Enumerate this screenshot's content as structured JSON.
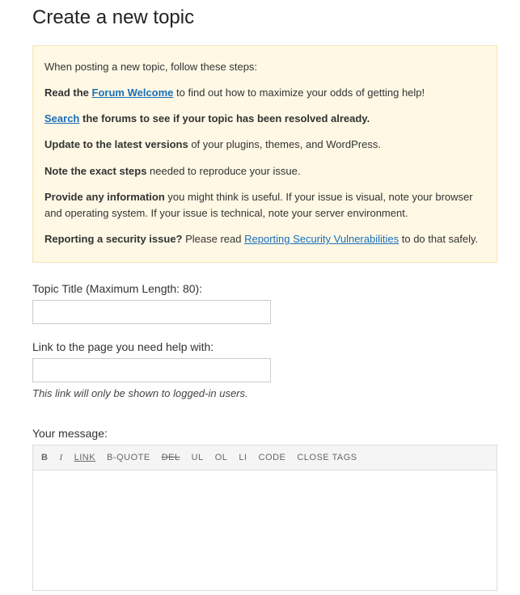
{
  "heading": "Create a new topic",
  "notice": {
    "intro": "When posting a new topic, follow these steps:",
    "read_prefix": "Read the ",
    "read_link": "Forum Welcome",
    "read_suffix": " to find out how to maximize your odds of getting help!",
    "search_link": "Search",
    "search_suffix": " the forums to see if your topic has been resolved already.",
    "update_bold": "Update to the latest versions",
    "update_suffix": " of your plugins, themes, and WordPress.",
    "note_bold": "Note the exact steps",
    "note_suffix": " needed to reproduce your issue.",
    "provide_bold": "Provide any information",
    "provide_suffix": " you might think is useful. If your issue is visual, note your browser and operating system. If your issue is technical, note your server environment.",
    "report_bold": "Reporting a security issue?",
    "report_mid": " Please read ",
    "report_link": "Reporting Security Vulnerabilities",
    "report_suffix": " to do that safely."
  },
  "form": {
    "title_label": "Topic Title (Maximum Length: 80):",
    "title_value": "",
    "link_label": "Link to the page you need help with:",
    "link_value": "",
    "link_hint": "This link will only be shown to logged-in users.",
    "message_label": "Your message:",
    "message_value": ""
  },
  "toolbar": {
    "b": "B",
    "i": "I",
    "link": "LINK",
    "bquote": "B-QUOTE",
    "del": "DEL",
    "ul": "UL",
    "ol": "OL",
    "li": "LI",
    "code": "CODE",
    "close": "CLOSE TAGS"
  }
}
